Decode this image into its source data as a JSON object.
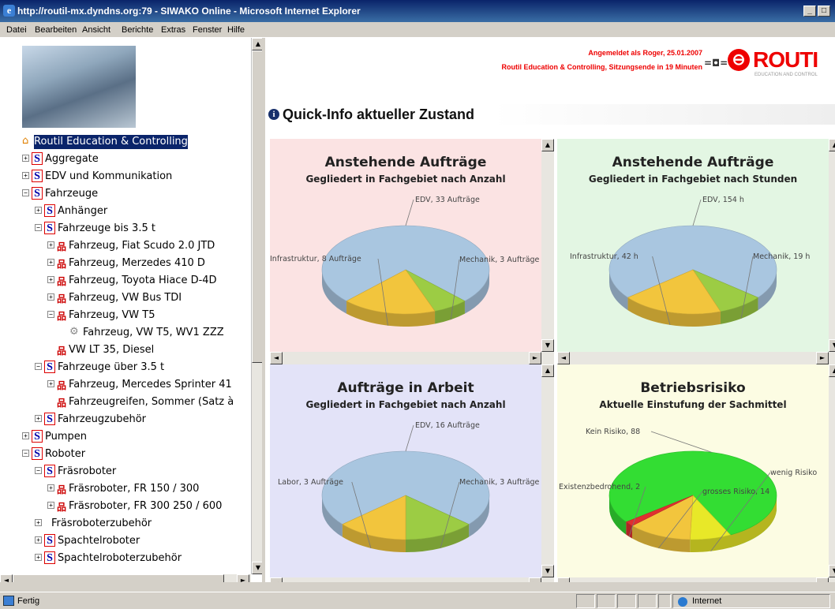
{
  "window": {
    "title": "http://routil-mx.dyndns.org:79 - SIWAKO Online - Microsoft Internet Explorer",
    "minimize": "_",
    "restore": "□"
  },
  "menu": [
    "Datei",
    "Bearbeiten",
    "Ansicht",
    "Berichte",
    "Extras",
    "Fenster",
    "Hilfe"
  ],
  "tree": [
    {
      "label": "Routil Education & Controlling",
      "level": 0,
      "icon": "home-icon",
      "toggle": "",
      "selected": true
    },
    {
      "label": "Aggregate",
      "level": 0,
      "icon": "s-icon",
      "toggle": "+"
    },
    {
      "label": "EDV und Kommunikation",
      "level": 0,
      "icon": "s-icon",
      "toggle": "+"
    },
    {
      "label": "Fahrzeuge",
      "level": 0,
      "icon": "s-icon",
      "toggle": "-"
    },
    {
      "label": "Anhänger",
      "level": 1,
      "icon": "s-icon",
      "toggle": "+"
    },
    {
      "label": "Fahrzeuge bis 3.5 t",
      "level": 1,
      "icon": "s-icon",
      "toggle": "-"
    },
    {
      "label": "Fahrzeug, Fiat Scudo 2.0 JTD",
      "level": 2,
      "icon": "org-icon",
      "toggle": "+"
    },
    {
      "label": "Fahrzeug, Merzedes 410 D",
      "level": 2,
      "icon": "org-icon",
      "toggle": "+"
    },
    {
      "label": "Fahrzeug, Toyota Hiace D-4D",
      "level": 2,
      "icon": "org-icon",
      "toggle": "+"
    },
    {
      "label": "Fahrzeug, VW Bus TDI",
      "level": 2,
      "icon": "org-icon",
      "toggle": "+"
    },
    {
      "label": "Fahrzeug, VW T5",
      "level": 2,
      "icon": "org-icon",
      "toggle": "-"
    },
    {
      "label": "Fahrzeug, VW T5, WV1 ZZZ",
      "level": 3,
      "icon": "gear-icon",
      "toggle": ""
    },
    {
      "label": "VW LT 35, Diesel",
      "level": 2,
      "icon": "org-icon",
      "toggle": ""
    },
    {
      "label": "Fahrzeuge über 3.5 t",
      "level": 1,
      "icon": "s-icon",
      "toggle": "-"
    },
    {
      "label": "Fahrzeug, Mercedes Sprinter 41",
      "level": 2,
      "icon": "org-icon",
      "toggle": "+"
    },
    {
      "label": "Fahrzeugreifen, Sommer (Satz à",
      "level": 2,
      "icon": "org-icon",
      "toggle": ""
    },
    {
      "label": "Fahrzeugzubehör",
      "level": 1,
      "icon": "s-icon",
      "toggle": "+"
    },
    {
      "label": "Pumpen",
      "level": 0,
      "icon": "s-icon",
      "toggle": "+"
    },
    {
      "label": "Roboter",
      "level": 0,
      "icon": "s-icon",
      "toggle": "-"
    },
    {
      "label": "Fräsroboter",
      "level": 1,
      "icon": "s-icon",
      "toggle": "-"
    },
    {
      "label": "Fräsroboter, FR 150 / 300",
      "level": 2,
      "icon": "org-icon",
      "toggle": "+"
    },
    {
      "label": "Fräsroboter, FR 300 250 / 600",
      "level": 2,
      "icon": "org-icon",
      "toggle": "+"
    },
    {
      "label": "Fräsroboterzubehör",
      "level": 1,
      "icon": "",
      "toggle": "+"
    },
    {
      "label": "Spachtelroboter",
      "level": 1,
      "icon": "s-icon",
      "toggle": "+"
    },
    {
      "label": "Spachtelroboterzubehör",
      "level": 1,
      "icon": "s-icon",
      "toggle": "+"
    }
  ],
  "header": {
    "login": "Angemeldet als Roger, 25.01.2007",
    "session": "Routil Education & Controlling, Sitzungsende in 19 Minuten",
    "logo_text": "ROUTI",
    "logo_sub": "EDUCATION AND CONTROL",
    "quick_info": "Quick-Info aktueller Zustand"
  },
  "chart_data": [
    {
      "type": "pie",
      "title": "Anstehende Aufträge",
      "subtitle": "Gegliedert in Fachgebiet nach Anzahl",
      "labels": [
        "EDV, 33 Aufträge",
        "Mechanik, 3 Aufträge",
        "Infrastruktur, 8 Aufträge"
      ],
      "values": [
        33,
        3,
        8
      ],
      "colors": [
        "#a9c6e0",
        "#9ccc44",
        "#f2c53d"
      ]
    },
    {
      "type": "pie",
      "title": "Anstehende Aufträge",
      "subtitle": "Gegliedert in Fachgebiet nach Stunden",
      "labels": [
        "EDV, 154 h",
        "Mechanik, 19 h",
        "Infrastruktur, 42 h"
      ],
      "values": [
        154,
        19,
        42
      ],
      "colors": [
        "#a9c6e0",
        "#9ccc44",
        "#f2c53d"
      ]
    },
    {
      "type": "pie",
      "title": "Aufträge in Arbeit",
      "subtitle": "Gegliedert in Fachgebiet nach Anzahl",
      "labels": [
        "EDV, 16 Aufträge",
        "Mechanik, 3 Aufträge",
        "Labor, 3 Aufträge"
      ],
      "values": [
        16,
        3,
        3
      ],
      "colors": [
        "#a9c6e0",
        "#9ccc44",
        "#f2c53d"
      ]
    },
    {
      "type": "pie",
      "title": "Betriebsrisiko",
      "subtitle": "Aktuelle Einstufung der Sachmittel",
      "labels": [
        "Kein Risiko, 88",
        "wenig Risiko",
        "grosses Risiko, 14",
        "Existenzbedrohend, 2"
      ],
      "values": [
        88,
        9,
        14,
        2
      ],
      "colors": [
        "#33dd33",
        "#e8e828",
        "#f2c53d",
        "#e03030"
      ]
    }
  ],
  "status": {
    "text": "Fertig",
    "zone": "Internet"
  }
}
